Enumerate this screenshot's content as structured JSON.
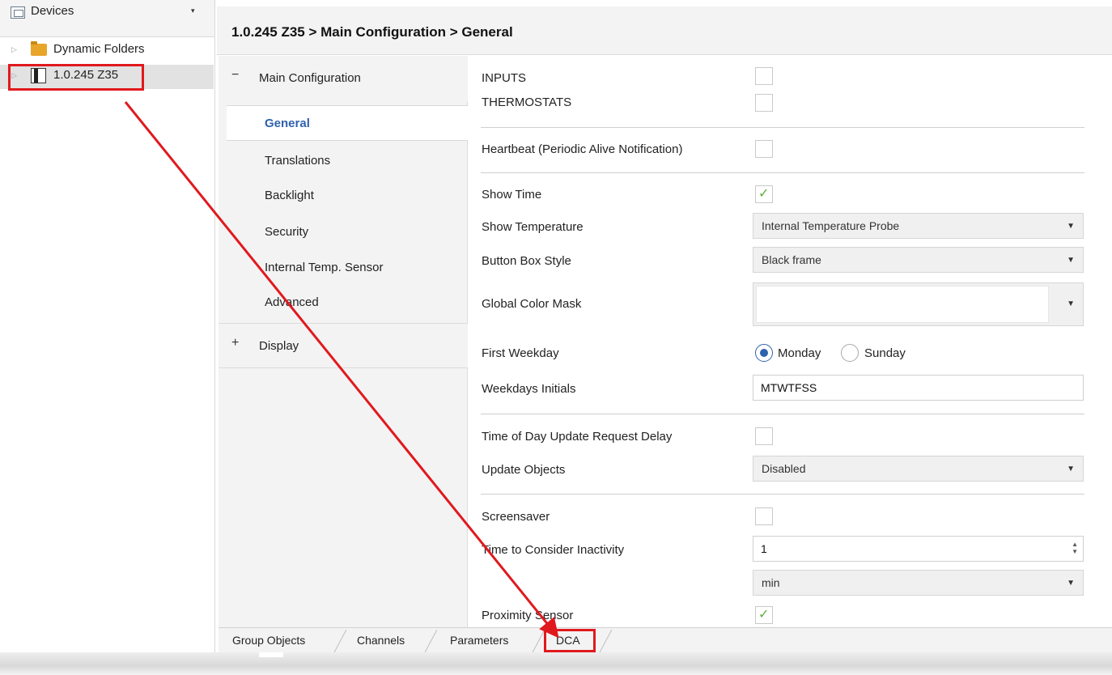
{
  "tree": {
    "header": {
      "title": "Devices",
      "icon": "devices-icon",
      "dropdown_glyph": "▾"
    },
    "items": [
      {
        "label": "Dynamic Folders",
        "icon": "folder-icon",
        "expander": "▷"
      },
      {
        "label": "1.0.245 Z35",
        "icon": "device-icon",
        "expander": "▷",
        "selected": true
      }
    ]
  },
  "breadcrumb": "1.0.245 Z35 > Main Configuration > General",
  "nav": {
    "main": {
      "sign": "−",
      "label": "Main Configuration"
    },
    "items": [
      "General",
      "Translations",
      "Backlight",
      "Security",
      "Internal Temp. Sensor",
      "Advanced"
    ],
    "active": "General",
    "display": {
      "sign": "+",
      "label": "Display"
    }
  },
  "params": {
    "inputs": {
      "label": "INPUTS",
      "checked": false
    },
    "thermostats": {
      "label": "THERMOSTATS",
      "checked": false
    },
    "heartbeat": {
      "label": "Heartbeat (Periodic Alive Notification)",
      "checked": false
    },
    "show_time": {
      "label": "Show Time",
      "checked": true
    },
    "show_temperature": {
      "label": "Show Temperature",
      "value": "Internal Temperature Probe"
    },
    "button_box_style": {
      "label": "Button Box Style",
      "value": "Black frame"
    },
    "global_color_mask": {
      "label": "Global Color Mask",
      "value": ""
    },
    "first_weekday": {
      "label": "First Weekday",
      "options": [
        "Monday",
        "Sunday"
      ],
      "selected": "Monday"
    },
    "weekdays_initials": {
      "label": "Weekdays Initials",
      "value": "MTWTFSS"
    },
    "tod_delay": {
      "label": "Time of Day Update Request Delay",
      "checked": false
    },
    "update_objects": {
      "label": "Update Objects",
      "value": "Disabled"
    },
    "screensaver": {
      "label": "Screensaver",
      "checked": false
    },
    "inactivity": {
      "label": "Time to Consider Inactivity",
      "value": "1",
      "unit": "min"
    },
    "proximity_sensor": {
      "label": "Proximity Sensor",
      "checked": true
    }
  },
  "tabs": [
    "Group Objects",
    "Channels",
    "Parameters",
    "DCA"
  ],
  "active_tab": "Parameters",
  "glyphs": {
    "caret": "▼",
    "spin_up": "▲",
    "spin_down": "▼"
  },
  "colors": {
    "accent": "#2f62ad",
    "check": "#5cb032",
    "annotation": "#e0191e"
  }
}
